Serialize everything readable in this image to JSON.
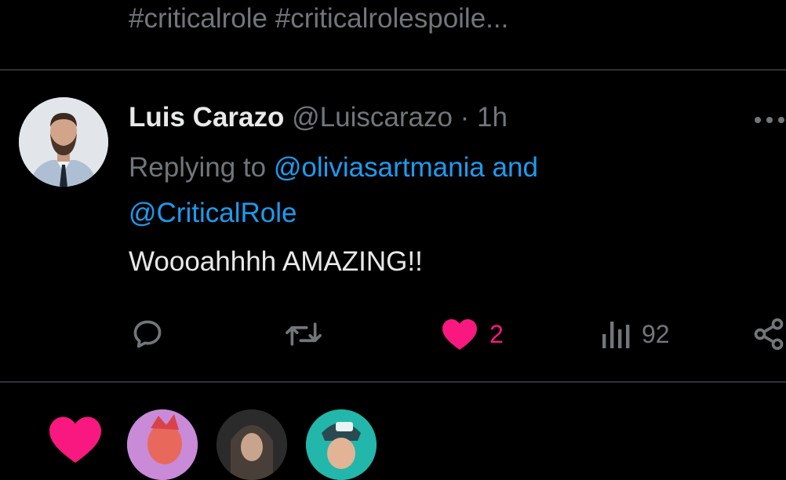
{
  "previous_tweet": {
    "hashtags": "#criticalrole #criticalrolespoile..."
  },
  "reply": {
    "author_name": "Luis Carazo",
    "author_handle": "@Luiscarazo",
    "separator": "·",
    "time": "1h",
    "replying_prefix": "Replying to",
    "mention_1": "@oliviasartmania",
    "conjunction": "and",
    "mention_2": "@CriticalRole",
    "text": "Woooahhhh AMAZING!!",
    "likes": "2",
    "views": "92"
  },
  "colors": {
    "background": "#000000",
    "text_primary": "#e7e9ea",
    "text_secondary": "#71767b",
    "link": "#1d9bf0",
    "like": "#f91880",
    "divider": "#2f3336"
  },
  "icons": {
    "reply": "reply-icon",
    "retweet": "retweet-icon",
    "like": "heart-icon",
    "views": "views-icon",
    "share": "share-icon",
    "more": "more-icon"
  }
}
